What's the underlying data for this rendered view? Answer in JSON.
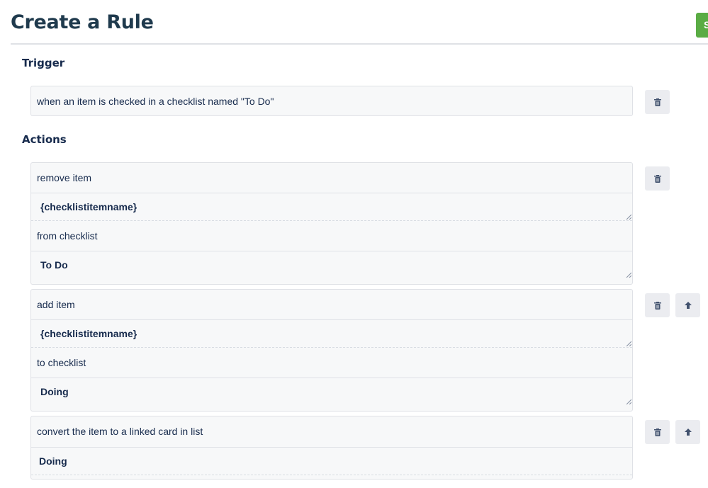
{
  "header": {
    "title": "Create a Rule",
    "save_label": "S"
  },
  "trigger": {
    "heading": "Trigger",
    "text": "when an item is checked in a checklist named \"To Do\""
  },
  "actions": {
    "heading": "Actions",
    "items": [
      {
        "text1": "remove item",
        "field1": "{checklistitemname}",
        "text2": "from checklist",
        "field2": "To Do"
      },
      {
        "text1": "add item",
        "field1": "{checklistitemname}",
        "text2": "to checklist",
        "field2": "Doing"
      },
      {
        "text1": "convert the item to a linked card in list",
        "field1": "Doing"
      }
    ]
  },
  "icons": {
    "delete": "trash-icon",
    "move_up": "arrow-up-icon"
  },
  "colors": {
    "save_button": "#5aac44",
    "card_background": "#f7f8f9",
    "icon_button": "#ebecf0"
  }
}
